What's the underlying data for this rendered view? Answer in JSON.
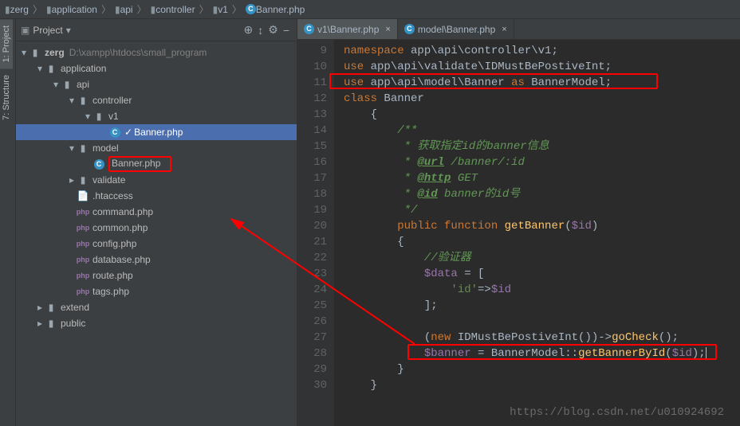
{
  "breadcrumbs": [
    "zerg",
    "application",
    "api",
    "controller",
    "v1",
    "Banner.php"
  ],
  "sidebar_tools": {
    "project": "1: Project",
    "structure": "7: Structure"
  },
  "project_header": {
    "label": "Project",
    "icons": {
      "target": "⊕",
      "collapse": "↕",
      "gear": "⚙",
      "hide": "−"
    }
  },
  "tree": {
    "root": {
      "name": "zerg",
      "path": "D:\\xampp\\htdocs\\small_program"
    },
    "application": "application",
    "api": "api",
    "controller": "controller",
    "v1": "v1",
    "banner_v1": "Banner.php",
    "model": "model",
    "banner_model": "Banner.php",
    "validate": "validate",
    "htaccess": ".htaccess",
    "command": "command.php",
    "common": "common.php",
    "config": "config.php",
    "database": "database.php",
    "route": "route.php",
    "tags": "tags.php",
    "extend": "extend",
    "public": "public"
  },
  "tabs": {
    "t1": "v1\\Banner.php",
    "t2": "model\\Banner.php"
  },
  "linenos": [
    "9",
    "10",
    "11",
    "12",
    "13",
    "14",
    "15",
    "16",
    "17",
    "18",
    "19",
    "20",
    "21",
    "22",
    "23",
    "24",
    "25",
    "26",
    "27",
    "28",
    "29",
    "30"
  ],
  "code": {
    "l9": {
      "a": "namespace",
      "b": " app\\api\\controller\\v1;"
    },
    "l10": {
      "a": "use",
      "b": " app\\api\\validate\\IDMustBePostiveInt;"
    },
    "l11": {
      "a": "use",
      "b": " app\\api\\model\\Banner ",
      "c": "as",
      "d": " BannerModel;"
    },
    "l12": {
      "a": "class",
      "b": " Banner"
    },
    "l13": "    {",
    "l14": "        /**",
    "l15": "         * 获取指定id的banner信息",
    "l16": {
      "a": "         * ",
      "b": "@url",
      "c": " /banner/:id"
    },
    "l17": {
      "a": "         * ",
      "b": "@http",
      "c": " GET"
    },
    "l18": {
      "a": "         * ",
      "b": "@id",
      "c": " banner的id号"
    },
    "l19": "         */",
    "l20": {
      "a": "        ",
      "b": "public function ",
      "c": "getBanner",
      "d": "(",
      "e": "$id",
      "f": ")"
    },
    "l21": "        {",
    "l22": "            //验证器",
    "l23": {
      "a": "            ",
      "b": "$data",
      "c": " = ["
    },
    "l24": {
      "a": "                ",
      "b": "'id'",
      "c": "=>",
      "d": "$id"
    },
    "l25": "            ];",
    "l27": {
      "a": "            (",
      "b": "new ",
      "c": "IDMustBePostiveInt())->",
      "d": "goCheck",
      "e": "();"
    },
    "l28": {
      "a": "            ",
      "b": "$banner",
      "c": " = BannerModel::",
      "d": "getBannerById",
      "e": "(",
      "f": "$id",
      "g": ");"
    },
    "l29": "        }",
    "l30": "    }"
  },
  "watermark": "https://blog.csdn.net/u010924692"
}
